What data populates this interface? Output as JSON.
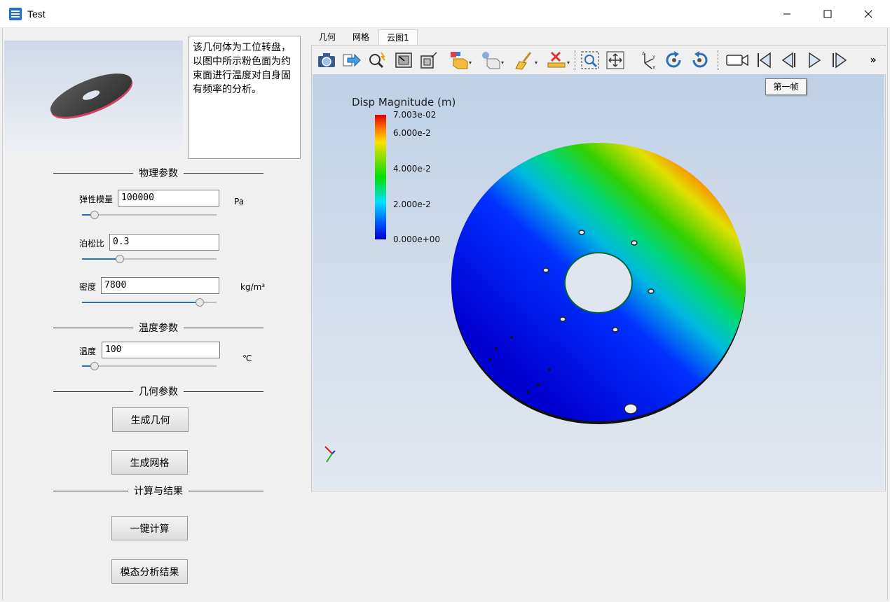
{
  "window": {
    "title": "Test"
  },
  "preview": {
    "description": "该几何体为工位转盘，以图中所示粉色面为约束面进行温度对自身固有频率的分析。"
  },
  "sections": {
    "physical": "物理参数",
    "temperature": "温度参数",
    "geometry": "几何参数",
    "compute": "计算与结果"
  },
  "params": {
    "elastic_modulus": {
      "label": "弹性模量",
      "value": "100000",
      "unit": "Pa",
      "slider_level": 0.1
    },
    "poisson_ratio": {
      "label": "泊松比",
      "value": "0.3",
      "slider_level": 0.3
    },
    "density": {
      "label": "密度",
      "value": "7800",
      "unit": "kg/m³",
      "slider_level": 0.88
    },
    "temperature": {
      "label": "温度",
      "value": "100",
      "unit": "℃",
      "slider_level": 0.1
    }
  },
  "buttons": {
    "generate_geometry": "生成几何",
    "generate_mesh": "生成网格",
    "one_click_compute": "一键计算",
    "modal_result": "模态分析结果"
  },
  "tabs": [
    "几何",
    "网格",
    "云图1"
  ],
  "toolbar": {
    "icons": [
      "camera-icon",
      "export-arrow-icon",
      "pick-icon",
      "view-fit-icon",
      "view-box-icon",
      "color-cube-icon",
      "light-cube-icon",
      "brush-icon",
      "measure-icon",
      "zoom-box-icon",
      "pan-icon",
      "axis-icon",
      "rotate-cw-icon",
      "rotate-ccw-icon",
      "record-icon",
      "first-frame-icon",
      "prev-frame-icon",
      "play-icon",
      "next-frame-icon"
    ],
    "overflow": "»",
    "tooltip": "第一帧"
  },
  "legend": {
    "title": "Disp Magnitude (m)",
    "ticks": [
      "7.003e-02",
      "6.000e-2",
      "4.000e-2",
      "2.000e-2",
      "0.000e+00"
    ],
    "colors": {
      "max": "#e00000",
      "high": "#ffe000",
      "mid": "#00e000",
      "low": "#00e0ff",
      "min": "#0000cc"
    }
  }
}
